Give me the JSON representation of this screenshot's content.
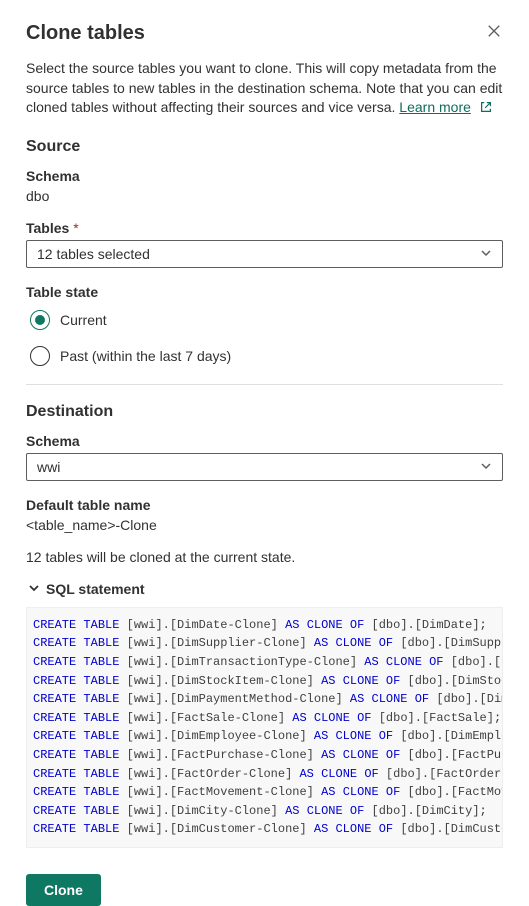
{
  "header": {
    "title": "Clone tables",
    "intro_prefix": "Select the source tables you want to clone. This will copy metadata from the source tables to new tables in the destination schema. Note that you can edit cloned tables without affecting their sources and vice versa. ",
    "learn_more": "Learn more"
  },
  "source": {
    "heading": "Source",
    "schema_label": "Schema",
    "schema_value": "dbo",
    "tables_label": "Tables",
    "tables_selected": "12 tables selected",
    "table_state_label": "Table state",
    "radio_current": "Current",
    "radio_past": "Past (within the last 7 days)",
    "selected_state": "current"
  },
  "destination": {
    "heading": "Destination",
    "schema_label": "Schema",
    "schema_value": "wwi",
    "default_name_label": "Default table name",
    "default_name_value": "<table_name>-Clone"
  },
  "status_line": "12 tables will be cloned at the current state.",
  "sql": {
    "header": "SQL statement",
    "statements": [
      {
        "dest": "[wwi].[DimDate-Clone]",
        "src": "[dbo].[DimDate]",
        "trunc": false
      },
      {
        "dest": "[wwi].[DimSupplier-Clone]",
        "src": "[dbo].[DimSupplier]",
        "trunc": false
      },
      {
        "dest": "[wwi].[DimTransactionType-Clone]",
        "src": "[dbo].[DimTra",
        "trunc": true
      },
      {
        "dest": "[wwi].[DimStockItem-Clone]",
        "src": "[dbo].[DimStockItem",
        "trunc": true
      },
      {
        "dest": "[wwi].[DimPaymentMethod-Clone]",
        "src": "[dbo].[DimPayme",
        "trunc": true
      },
      {
        "dest": "[wwi].[FactSale-Clone]",
        "src": "[dbo].[FactSale]",
        "trunc": false
      },
      {
        "dest": "[wwi].[DimEmployee-Clone]",
        "src": "[dbo].[DimEmployee]",
        "trunc": false
      },
      {
        "dest": "[wwi].[FactPurchase-Clone]",
        "src": "[dbo].[FactPurchase",
        "trunc": true
      },
      {
        "dest": "[wwi].[FactOrder-Clone]",
        "src": "[dbo].[FactOrder]",
        "trunc": false
      },
      {
        "dest": "[wwi].[FactMovement-Clone]",
        "src": "[dbo].[FactMovement",
        "trunc": true
      },
      {
        "dest": "[wwi].[DimCity-Clone]",
        "src": "[dbo].[DimCity]",
        "trunc": false
      },
      {
        "dest": "[wwi].[DimCustomer-Clone]",
        "src": "[dbo].[DimCustomer]",
        "trunc": false
      }
    ]
  },
  "actions": {
    "clone": "Clone"
  }
}
